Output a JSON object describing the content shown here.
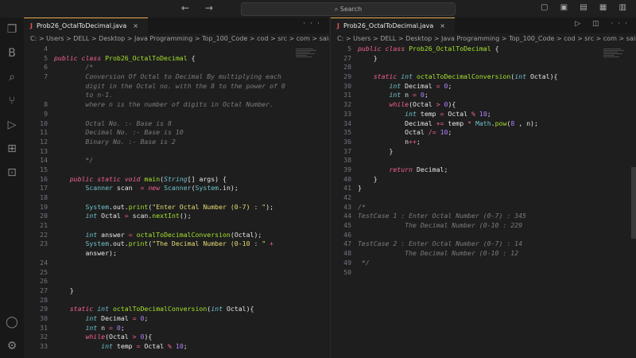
{
  "titlebar": {
    "search": "Search"
  },
  "left": {
    "tab": "Prob26_OctalToDecimal.java",
    "breadcrumb": "C: > Users > DELL > Desktop > Java Programming > Top_100_Code > cod > src > com > sainath > ...",
    "lines": [
      [
        "4",
        ""
      ],
      [
        "5",
        "public class Prob26_OctalToDecimal {"
      ],
      [
        "6",
        "        /*"
      ],
      [
        "7",
        "        Conversion Of Octal to Decimal By multiplying each"
      ],
      [
        "",
        "        digit in the Octal no. with the 8 to the power of 0"
      ],
      [
        "",
        "        to n-1."
      ],
      [
        "8",
        "        where n is the number of digits in Octal Number."
      ],
      [
        "9",
        ""
      ],
      [
        "10",
        "        Octal No. :- Base is 8"
      ],
      [
        "11",
        "        Decimal No. :- Base is 10"
      ],
      [
        "12",
        "        Binary No. :- Base is 2"
      ],
      [
        "13",
        ""
      ],
      [
        "14",
        "        */"
      ],
      [
        "15",
        ""
      ],
      [
        "16",
        "    public static void main(String[] args) {"
      ],
      [
        "17",
        "        Scanner scan  = new Scanner(System.in);"
      ],
      [
        "18",
        ""
      ],
      [
        "19",
        "        System.out.print(\"Enter Octal Number (0-7) : \");"
      ],
      [
        "20",
        "        int Octal = scan.nextInt();"
      ],
      [
        "21",
        ""
      ],
      [
        "22",
        "        int answer = octalToDecimalConversion(Octal);"
      ],
      [
        "23",
        "        System.out.print(\"The Decimal Number (0-10 : \" +"
      ],
      [
        "",
        "        answer);"
      ],
      [
        "24",
        ""
      ],
      [
        "25",
        ""
      ],
      [
        "26",
        ""
      ],
      [
        "27",
        "    }"
      ],
      [
        "28",
        ""
      ],
      [
        "29",
        "    static int octalToDecimalConversion(int Octal){"
      ],
      [
        "30",
        "        int Decimal = 0;"
      ],
      [
        "31",
        "        int n = 0;"
      ],
      [
        "32",
        "        while(Octal > 0){"
      ],
      [
        "33",
        "            int temp = Octal % 10;"
      ]
    ]
  },
  "right": {
    "tab": "Prob26_OctalToDecimal.java",
    "breadcrumb": "C: > Users > DELL > Desktop > Java Programming > Top_100_Code > cod > src > com > sainath",
    "lines": [
      [
        "5",
        "public class Prob26_OctalToDecimal {"
      ],
      [
        "27",
        "    }"
      ],
      [
        "28",
        ""
      ],
      [
        "29",
        "    static int octalToDecimalConversion(int Octal){"
      ],
      [
        "30",
        "        int Decimal = 0;"
      ],
      [
        "31",
        "        int n = 0;"
      ],
      [
        "32",
        "        while(Octal > 0){"
      ],
      [
        "33",
        "            int temp = Octal % 10;"
      ],
      [
        "34",
        "            Decimal += temp * Math.pow(8 , n);"
      ],
      [
        "35",
        "            Octal /= 10;"
      ],
      [
        "36",
        "            n++;"
      ],
      [
        "37",
        "        }"
      ],
      [
        "38",
        ""
      ],
      [
        "39",
        "        return Decimal;"
      ],
      [
        "40",
        "    }"
      ],
      [
        "41",
        "}"
      ],
      [
        "42",
        ""
      ],
      [
        "43",
        "/*"
      ],
      [
        "44",
        "TestCase 1 : Enter Octal Number (0-7) : 345"
      ],
      [
        "45",
        "            The Decimal Number (0-10 : 229"
      ],
      [
        "46",
        ""
      ],
      [
        "47",
        "TestCase 2 : Enter Octal Number (0-7) : 14"
      ],
      [
        "48",
        "            The Decimal Number (0-10 : 12"
      ],
      [
        "49",
        " */"
      ],
      [
        "50",
        ""
      ]
    ]
  }
}
